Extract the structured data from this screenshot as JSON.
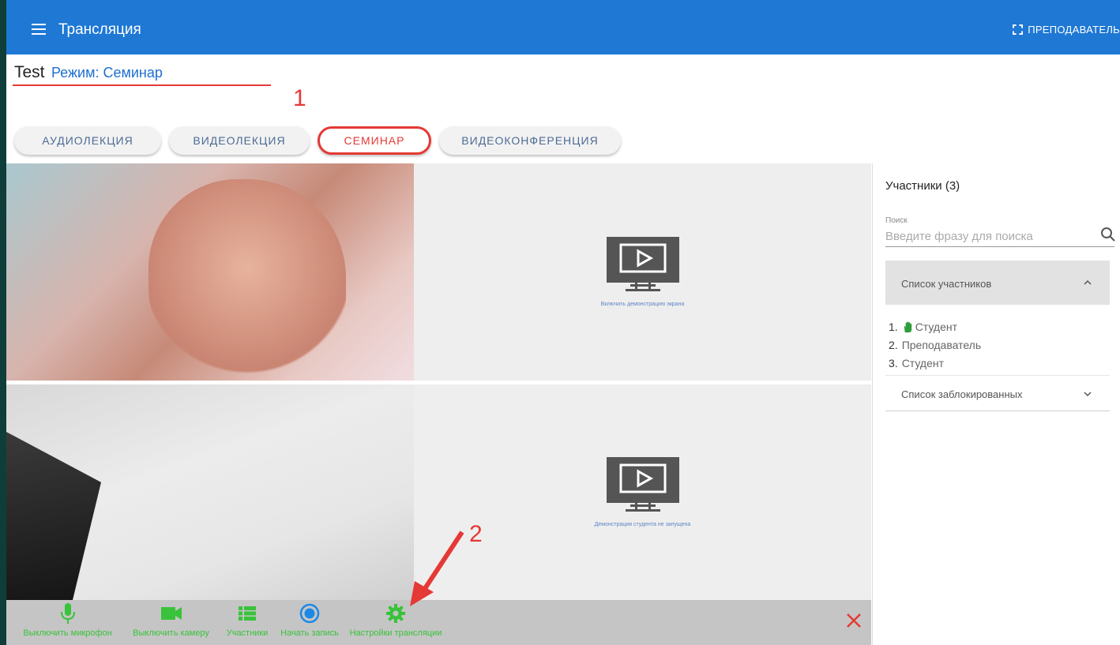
{
  "topbar": {
    "title": "Трансляция",
    "role": "ПРЕПОДАВАТЕЛЬ"
  },
  "header": {
    "course": "Test",
    "mode_text": "Режим: Семинар",
    "annotation_1": "1"
  },
  "modes": [
    {
      "label": "АУДИОЛЕКЦИЯ"
    },
    {
      "label": "ВИДЕОЛЕКЦИЯ"
    },
    {
      "label": "СЕМИНАР",
      "selected": true
    },
    {
      "label": "ВИДЕОКОНФЕРЕНЦИЯ"
    }
  ],
  "screens": {
    "screen1_caption": "Включить демонстрацию экрана",
    "screen2_caption": "Демонстрация студента не запущена"
  },
  "toolbar": {
    "mic": "Выключить микрофон",
    "camera": "Выключить камеру",
    "participants": "Участники",
    "record": "Начать запись",
    "settings": "Настройки трансляции",
    "annotation_2": "2"
  },
  "sidebar": {
    "title": "Участники (3)",
    "search_label": "Поиск",
    "search_placeholder": "Введите фразу для поиска",
    "participants_panel": "Список участников",
    "participants": [
      {
        "num": "1.",
        "name": "Студент",
        "hand_raised": true
      },
      {
        "num": "2.",
        "name": "Преподаватель"
      },
      {
        "num": "3.",
        "name": "Студент"
      }
    ],
    "blocked_panel": "Список заблокированных"
  },
  "colors": {
    "topbar": "#1e78d4",
    "accent_red": "#e53935",
    "toolbar_green": "#38c33a",
    "record_blue": "#1e88e5"
  }
}
